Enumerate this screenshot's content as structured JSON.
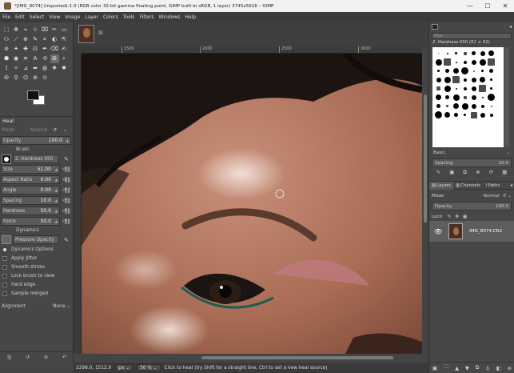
{
  "window": {
    "title": "*[IMG_8074] (imported)-1.0 (RGB color 32-bit gamma floating point, GIMP built-in sRGB, 1 layer) 3745x5626 – GIMP",
    "minimize": "—",
    "maximize": "☐",
    "close": "✕"
  },
  "menu": [
    "File",
    "Edit",
    "Select",
    "View",
    "Image",
    "Layer",
    "Colors",
    "Tools",
    "Filters",
    "Windows",
    "Help"
  ],
  "tool_icons": [
    "⬚",
    "✥",
    "⌖",
    "⊹",
    "⌧",
    "✂",
    "▭",
    "⬭",
    "⟋",
    "⊕",
    "✎",
    "⌗",
    "◐",
    "⇱",
    "⊘",
    "✦",
    "✚",
    "⊡",
    "✒",
    "⌫",
    "✍",
    "⬢",
    "◉",
    "≋",
    "A",
    "⟲",
    "⊞",
    "⌕",
    "⟟",
    "✧",
    "⊿",
    "⬌",
    "◍",
    "❖",
    "✹",
    "✇",
    "⚲",
    "⌬",
    "⊚",
    "⊙"
  ],
  "colors": {
    "foreground": "#111111",
    "background": "#ffffff"
  },
  "tool_options": {
    "header": "Heal",
    "mode_label": "Mode",
    "mode_value": "Normal",
    "opacity_label": "Opacity",
    "opacity_value": "100.0",
    "brush_label": "Brush",
    "brush_value": "2. Hardness 050",
    "sliders": [
      {
        "label": "Size",
        "value": "51.00"
      },
      {
        "label": "Aspect Ratio",
        "value": "0.00"
      },
      {
        "label": "Angle",
        "value": "0.00"
      },
      {
        "label": "Spacing",
        "value": "10.0"
      },
      {
        "label": "Hardness",
        "value": "50.0"
      },
      {
        "label": "Force",
        "value": "50.0"
      }
    ],
    "dynamics_label": "Dynamics",
    "dynamics_value": "Pressure Opacity",
    "dynamics_options": "Dynamics Options",
    "checkboxes": [
      "Apply Jitter",
      "Smooth stroke",
      "Lock brush to view",
      "Hard edge",
      "Sample merged"
    ],
    "alignment_label": "Alignment",
    "alignment_value": "None"
  },
  "rulers": {
    "top": [
      "1500",
      "2000",
      "2500",
      "3000"
    ]
  },
  "status": {
    "coords": "2298.0, 1512.0",
    "unit": "px",
    "zoom": "50 %",
    "message": "Click to heal (try Shift for a straight line, Ctrl to set a new heal source)"
  },
  "brushes": {
    "filter_placeholder": "filter",
    "current": "2. Hardness 050 (51 × 51)",
    "basic_label": "Basic,",
    "spacing_label": "Spacing",
    "spacing_value": "10.0"
  },
  "layers": {
    "tabs": [
      "Layers",
      "Channels",
      "Paths"
    ],
    "mode_label": "Mode",
    "mode_value": "Normal",
    "opacity_label": "Opacity",
    "opacity_value": "100.0",
    "lock_label": "Lock:",
    "layer_name": "IMG_8074.CR2"
  }
}
